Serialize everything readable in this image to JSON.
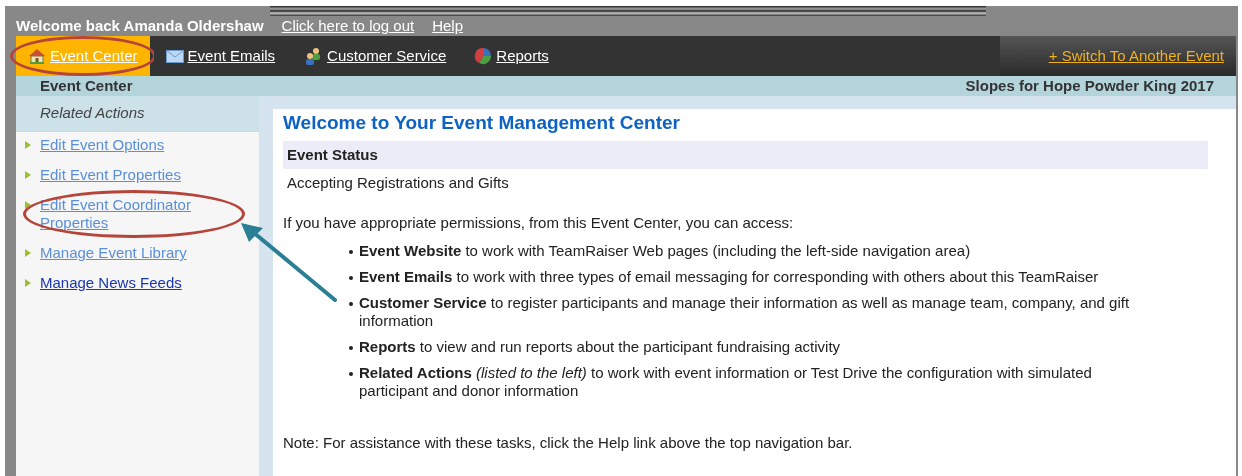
{
  "top_bar": {
    "welcome": "Welcome back Amanda Oldershaw",
    "links": [
      "Click here to log out",
      "Help"
    ]
  },
  "nav": {
    "tabs": [
      {
        "label": "Event Center",
        "kind": "house",
        "selected": true,
        "circled": true
      },
      {
        "label": "Event Emails",
        "kind": "envelope",
        "selected": false,
        "circled": false
      },
      {
        "label": "Customer Service",
        "kind": "people",
        "selected": false,
        "circled": false
      },
      {
        "label": "Reports",
        "kind": "chart",
        "selected": false,
        "circled": false
      }
    ],
    "switch_link": "+ Switch To Another Event"
  },
  "sub_header": {
    "section": "Event Center",
    "event_name": "Slopes for Hope Powder King 2017"
  },
  "sidebar": {
    "heading": "Related Actions",
    "items": [
      {
        "label": "Edit Event Options",
        "visited": true,
        "circled": false,
        "arrow": false
      },
      {
        "label": "Edit Event Properties",
        "visited": true,
        "circled": false,
        "arrow": false
      },
      {
        "label": "Edit Event Coordinator Properties",
        "visited": true,
        "circled": true,
        "arrow": true
      },
      {
        "label": "Manage Event Library",
        "visited": true,
        "circled": false,
        "arrow": false
      },
      {
        "label": "Manage News Feeds",
        "visited": false,
        "circled": false,
        "arrow": false
      }
    ]
  },
  "main": {
    "title": "Welcome to Your Event Management Center",
    "status_heading": "Event Status",
    "status_value": "Accepting Registrations and Gifts",
    "intro": "If you have appropriate permissions, from this Event Center, you can access:",
    "bullets": [
      "**Event Website** to work with TeamRaiser Web pages (including the left-side navigation area)",
      "**Event Emails** to work with three types of email messaging for corresponding with others about this TeamRaiser",
      "**Customer Service** to register participants and manage their information as well as manage team, company, and gift information",
      "**Reports** to view and run reports about the participant fundraising activity",
      "**Related Actions** *(listed to the left)* to work with event information or Test Drive the configuration with simulated participant and donor information"
    ],
    "note": "Note: For assistance with these tasks, click the Help link above the top navigation bar."
  }
}
